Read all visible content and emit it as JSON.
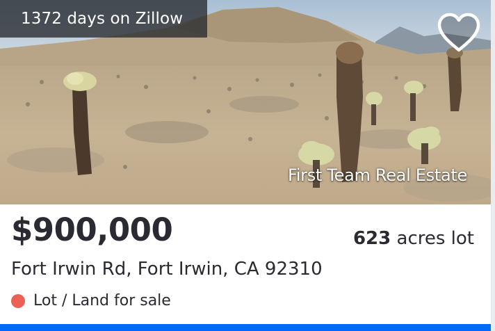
{
  "listing": {
    "days_on_zillow": "1372 days on Zillow",
    "attribution": "First Team Real Estate",
    "price": "$900,000",
    "lot_size_number": "623",
    "lot_size_unit": " acres lot",
    "address": "Fort Irwin Rd, Fort Irwin, CA 92310",
    "status_label": "Lot / Land for sale"
  },
  "icons": {
    "favorite": "heart-outline-icon",
    "status": "status-dot-icon"
  },
  "colors": {
    "status_dot": "#eb6155",
    "accent_bar": "#006aff",
    "text": "#2a2a33"
  }
}
